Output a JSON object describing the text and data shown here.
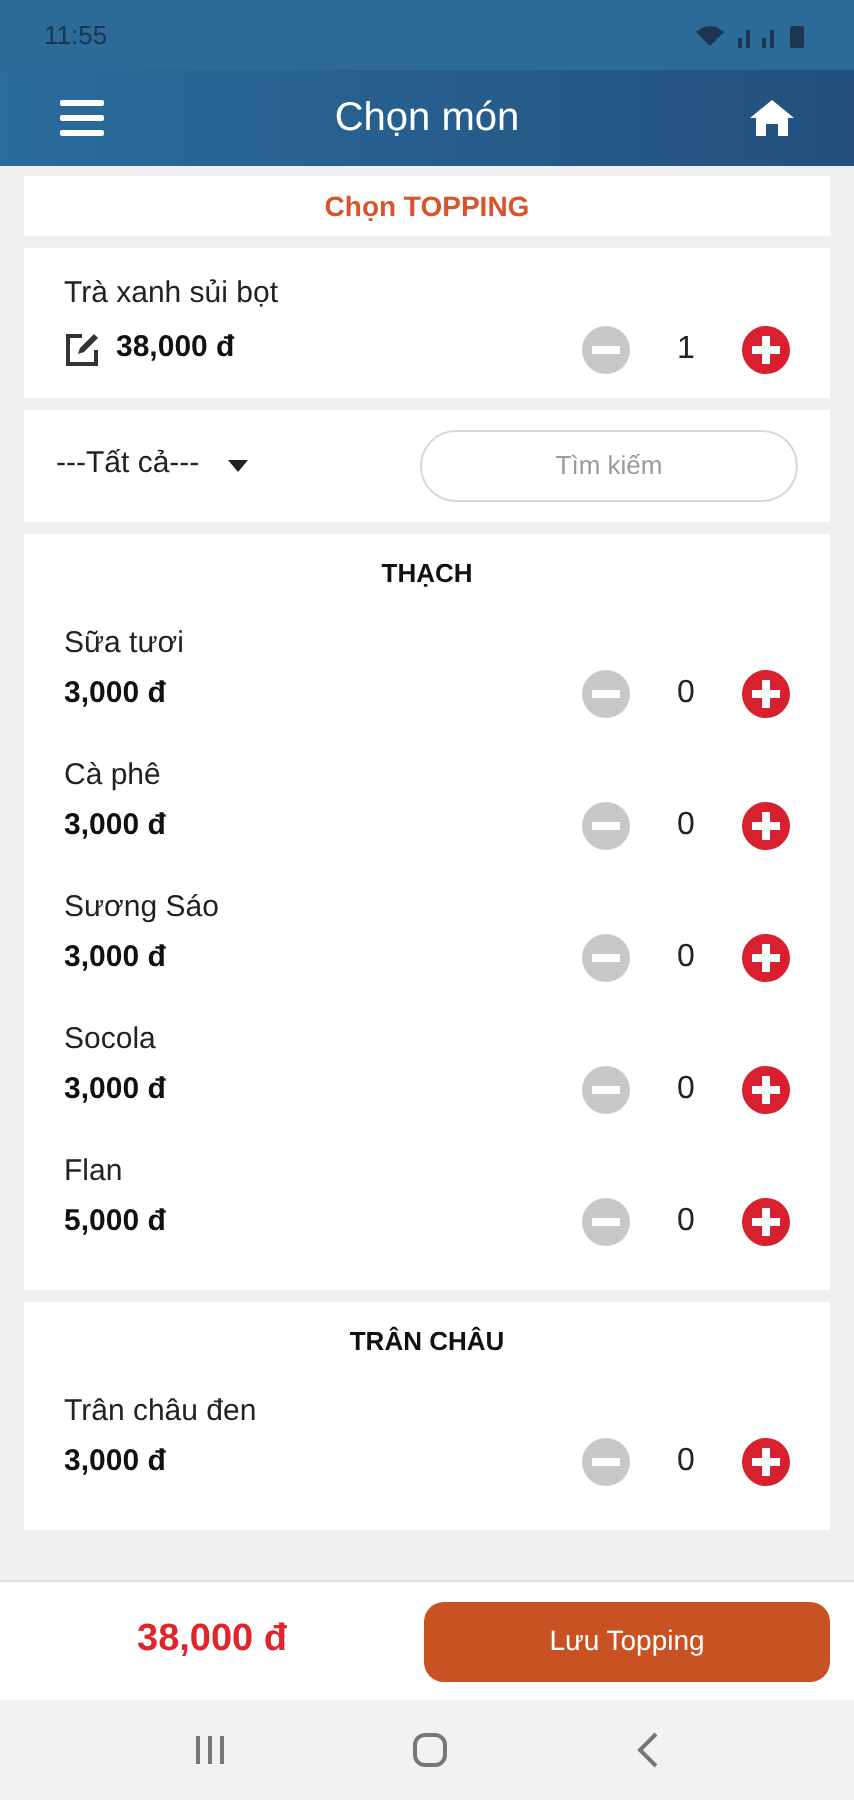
{
  "status_bar": {
    "time": "11:55"
  },
  "header": {
    "title": "Chọn món"
  },
  "section_title": "Chọn TOPPING",
  "product": {
    "name": "Trà xanh sủi bọt",
    "price": "38,000 đ",
    "quantity": "1"
  },
  "filter": {
    "category": "---Tất cả---",
    "search_placeholder": "Tìm kiếm"
  },
  "groups": [
    {
      "title": "THẠCH",
      "items": [
        {
          "name": "Sữa tươi",
          "price": "3,000 đ",
          "quantity": "0"
        },
        {
          "name": "Cà phê",
          "price": "3,000 đ",
          "quantity": "0"
        },
        {
          "name": "Sương Sáo",
          "price": "3,000 đ",
          "quantity": "0"
        },
        {
          "name": "Socola",
          "price": "3,000 đ",
          "quantity": "0"
        },
        {
          "name": "Flan",
          "price": "5,000 đ",
          "quantity": "0"
        }
      ]
    },
    {
      "title": "TRÂN CHÂU",
      "items": [
        {
          "name": "Trân châu đen",
          "price": "3,000 đ",
          "quantity": "0"
        }
      ]
    }
  ],
  "footer": {
    "total": "38,000 đ",
    "save_button": "Lưu Topping"
  }
}
